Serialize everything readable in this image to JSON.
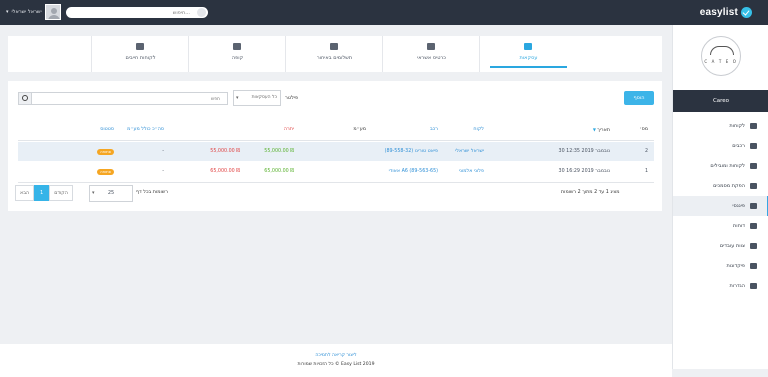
{
  "topbar": {
    "brand": "easylist",
    "user_name": "ישראל ישראלי",
    "search_placeholder": "חיפוש...",
    "colors": {
      "bar": "#2b3340",
      "accent": "#36c0e8"
    }
  },
  "sidebar": {
    "logo_text": "C A T E O",
    "title": "Careo",
    "items": [
      {
        "label": "לקוחות",
        "icon": "dashboard-icon",
        "active": false
      },
      {
        "label": "רכבים",
        "icon": "car-icon",
        "active": false
      },
      {
        "label": "לקוחות ומובילים",
        "icon": "users-icon",
        "active": false
      },
      {
        "label": "הפקת מסמכים",
        "icon": "edit-icon",
        "active": false
      },
      {
        "label": "פיננסי",
        "icon": "calculator-icon",
        "active": true
      },
      {
        "label": "דוחות",
        "icon": "report-icon",
        "active": false
      },
      {
        "label": "צוות עובדים",
        "icon": "team-icon",
        "active": false
      },
      {
        "label": "פיקדונות",
        "icon": "deposit-icon",
        "active": false
      },
      {
        "label": "הגדרות",
        "icon": "settings-icon",
        "active": false
      }
    ]
  },
  "tabs": [
    {
      "label": "עסקאות",
      "icon": "briefcase-icon",
      "active": true
    },
    {
      "label": "כרטיס אשראי",
      "icon": "credit-card-icon",
      "active": false
    },
    {
      "label": "תשלומים באיחור",
      "icon": "hourglass-icon",
      "active": false
    },
    {
      "label": "קופה",
      "icon": "cash-register-icon",
      "active": false
    },
    {
      "label": "לקוחות חייבים",
      "icon": "user-plus-icon",
      "active": false
    }
  ],
  "toolbar": {
    "new_label": "הוסף",
    "filter_label": "פילטר",
    "filter_value": "כל העסקאות",
    "search_placeholder": "חפש"
  },
  "table": {
    "headers": {
      "num": "מס׳",
      "date": "תאריך",
      "customer": "לקוח",
      "vehicle": "רכב",
      "vat": "מע״מ",
      "total": "סה״כ",
      "paid": "יתרה",
      "balance": "סה״כ כולל מע״מ",
      "status": "סטטוס"
    },
    "rows": [
      {
        "num": "2",
        "date": "30 נובמבר 2019 12:35",
        "customer": "ישראל ישראלי",
        "vehicle": "פיאט טורינו (89-558-32)",
        "total": "55,000.00 ₪",
        "paid": "55,000.00 ₪",
        "dash": "-",
        "status": "פתוחה"
      },
      {
        "num": "1",
        "date": "30 נובמבר 2019 16:29",
        "customer": "פלוני אלמוני",
        "vehicle": "אאודי A6 (89-563-65)",
        "total": "65,000.00 ₪",
        "paid": "65,000.00 ₪",
        "dash": "-",
        "status": "פתוחה"
      }
    ]
  },
  "pagination": {
    "summary": "מציג 1 עד 2 מתוך 2 רשומות",
    "per_page_label": "רשומות בכל דף",
    "per_page": "25",
    "prev": "הקודם",
    "current": "1",
    "next": "הבא"
  },
  "footer": {
    "line1": "ליצור קריאה לתמיכה",
    "line2": "כל הזכויות שמורות © Easy List 2019"
  }
}
